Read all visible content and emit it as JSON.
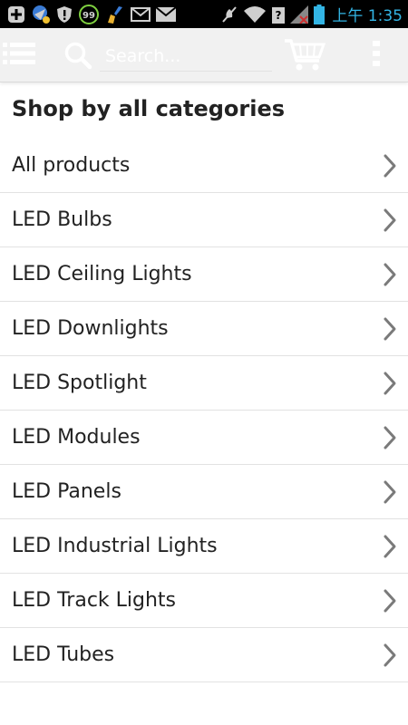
{
  "status_bar": {
    "time": "上午 1:35",
    "icons": [
      "add-box-icon",
      "map-marker-icon",
      "shield-alert-icon",
      "badge-99-icon",
      "broom-icon",
      "mail-icon",
      "mail-filled-icon",
      "mute-icon",
      "wifi-icon",
      "signal-icon",
      "battery-icon"
    ],
    "badge_count": "99"
  },
  "action_bar": {
    "menu_icon": "hamburger-list-icon",
    "search_icon": "search-icon",
    "search_placeholder": "Search...",
    "cart_icon": "cart-icon",
    "overflow_icon": "overflow-menu-icon"
  },
  "content": {
    "title": "Shop by all categories",
    "categories": [
      {
        "label": "All products"
      },
      {
        "label": "LED Bulbs"
      },
      {
        "label": "LED Ceiling Lights"
      },
      {
        "label": "LED Downlights"
      },
      {
        "label": "LED Spotlight"
      },
      {
        "label": "LED Modules"
      },
      {
        "label": "LED Panels"
      },
      {
        "label": "LED Industrial Lights"
      },
      {
        "label": "LED Track Lights"
      },
      {
        "label": "LED Tubes"
      }
    ]
  },
  "colors": {
    "accent": "#33b5e5",
    "text": "#222222",
    "divider": "#e2e2e2",
    "action_bar_bg": "#f1f1f1"
  }
}
